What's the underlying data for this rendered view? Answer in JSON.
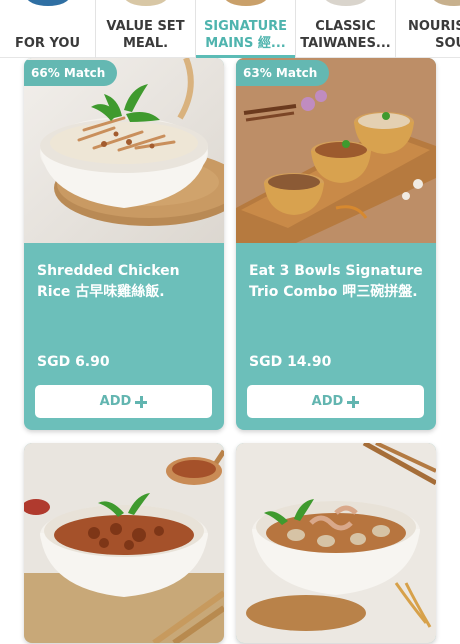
{
  "colors": {
    "accent": "#5cbcb6",
    "card_bg": "#6cbfba",
    "text_on_card": "#ffffff"
  },
  "tabs": [
    {
      "label": "FOR YOU",
      "active": false
    },
    {
      "label": "VALUE SET\nMEAL.",
      "active": false
    },
    {
      "label": "SIGNATURE\nMAINS 經...",
      "active": true
    },
    {
      "label": "CLASSIC\nTAIWANES...",
      "active": false
    },
    {
      "label": "NOURISH\nSOUP",
      "active": false
    }
  ],
  "products": [
    {
      "match": "66% Match",
      "title": "Shredded Chicken Rice 古早味雞絲飯.",
      "price": "SGD 6.90",
      "add_label": "ADD"
    },
    {
      "match": "63% Match",
      "title": "Eat 3 Bowls Signature Trio Combo 呷三碗拼盤.",
      "price": "SGD 14.90",
      "add_label": "ADD"
    },
    {
      "image": "braised pork rice bowl"
    },
    {
      "image": "oyster and intestine vermicelli bowl"
    }
  ]
}
